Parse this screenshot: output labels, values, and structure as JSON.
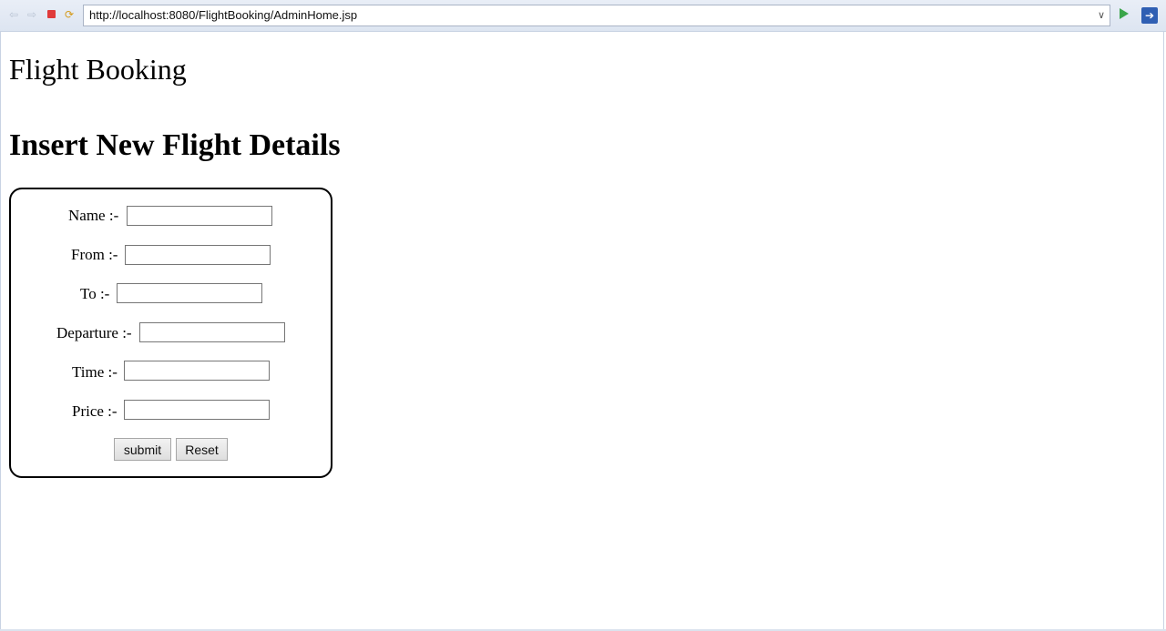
{
  "browser": {
    "url": "http://localhost:8080/FlightBooking/AdminHome.jsp"
  },
  "page": {
    "site_title": "Flight Booking",
    "heading": "Insert New Flight Details"
  },
  "form": {
    "fields": [
      {
        "label": "Name :-",
        "value": ""
      },
      {
        "label": "From :-",
        "value": ""
      },
      {
        "label": "To :-",
        "value": ""
      },
      {
        "label": "Departure :-",
        "value": ""
      },
      {
        "label": "Time :-",
        "value": ""
      },
      {
        "label": "Price :-",
        "value": ""
      }
    ],
    "submit_label": "submit",
    "reset_label": "Reset"
  },
  "icons": {
    "back": "back-arrow-icon",
    "forward": "forward-arrow-icon",
    "stop": "stop-icon",
    "refresh": "refresh-icon",
    "go": "go-icon",
    "external": "open-external-icon"
  }
}
